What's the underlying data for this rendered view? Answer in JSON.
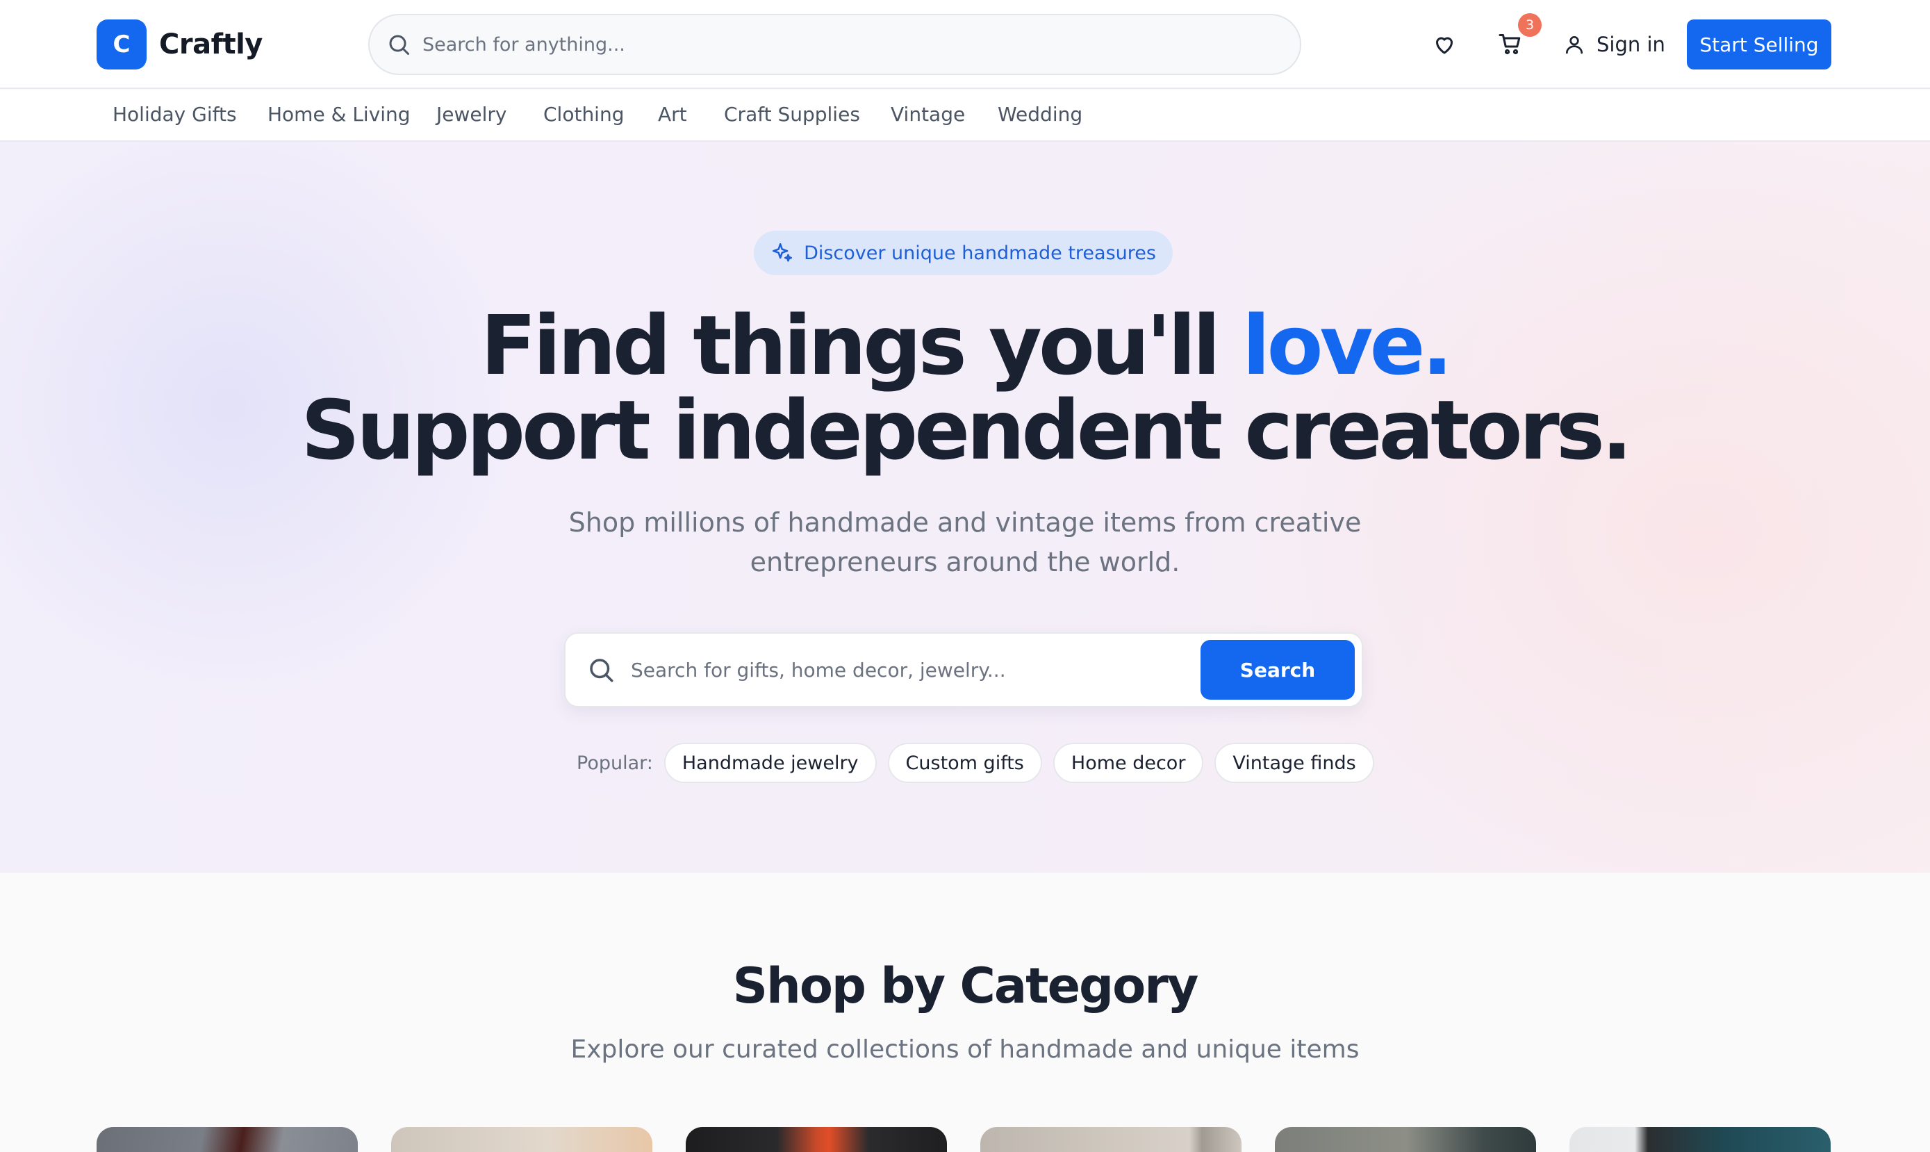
{
  "header": {
    "logo_letter": "C",
    "brand": "Craftly",
    "search_placeholder": "Search for anything...",
    "cart_count": "3",
    "signin_label": "Sign in",
    "start_selling_label": "Start Selling"
  },
  "nav": {
    "items": [
      "Holiday Gifts",
      "Home & Living",
      "Jewelry",
      "Clothing",
      "Art",
      "Craft Supplies",
      "Vintage",
      "Wedding"
    ]
  },
  "hero": {
    "badge": "Discover unique handmade treasures",
    "title_line1": "Find things you'll ",
    "title_accent": "love.",
    "title_line2": "Support independent creators.",
    "subtitle": "Shop millions of handmade and vintage items from creative entrepreneurs around the world.",
    "search_placeholder": "Search for gifts, home decor, jewelry...",
    "search_button": "Search",
    "popular_label": "Popular:",
    "popular_tags": [
      "Handmade jewelry",
      "Custom gifts",
      "Home decor",
      "Vintage finds"
    ]
  },
  "categories": {
    "title": "Shop by Category",
    "subtitle": "Explore our curated collections of handmade and unique items"
  },
  "colors": {
    "accent": "#1468f0",
    "badge": "#f0725a"
  }
}
